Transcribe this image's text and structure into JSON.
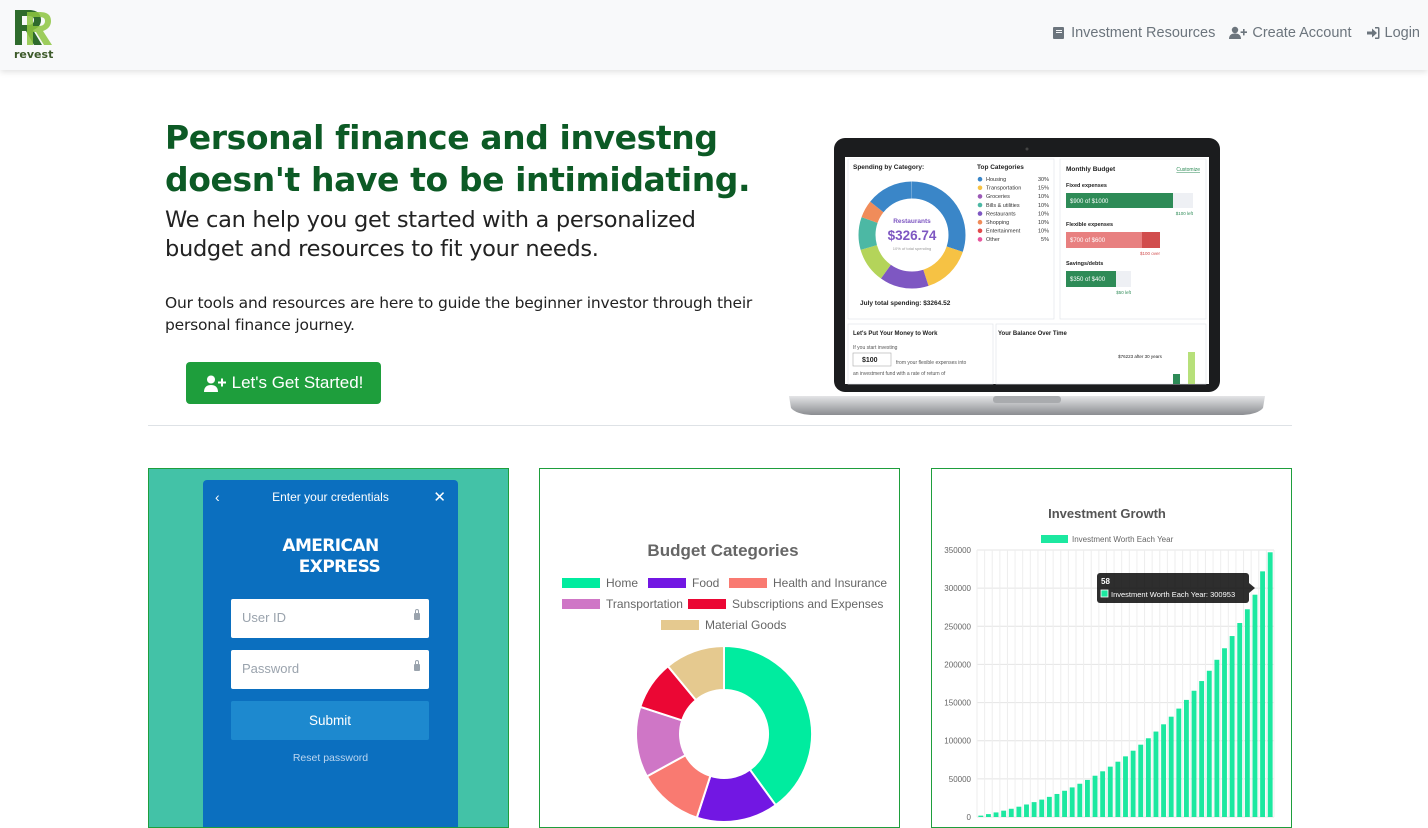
{
  "nav": {
    "brand": "revest",
    "links": [
      {
        "label": "Investment Resources",
        "icon": "book-icon"
      },
      {
        "label": "Create Account",
        "icon": "user-plus-icon"
      },
      {
        "label": "Login",
        "icon": "sign-in-icon"
      }
    ]
  },
  "hero": {
    "title": "Personal finance and investng doesn't have to be intimidating.",
    "subtitle": "We can help you get started with a personalized budget and resources to fit your needs.",
    "body": "Our tools and resources are here to guide the beginner investor through their personal finance journey.",
    "cta_label": "Let's Get Started!"
  },
  "laptop": {
    "spending_title": "Spending by Category:",
    "donut_label": "Restaurants",
    "donut_amount": "$326.74",
    "donut_note": "10% of total spending",
    "total": "July total spending: $3264.52",
    "top_categories_title": "Top Categories",
    "top_categories": [
      {
        "name": "Housing",
        "pct": "30%",
        "color": "#3a86c8"
      },
      {
        "name": "Transportation",
        "pct": "15%",
        "color": "#f6c244"
      },
      {
        "name": "Groceries",
        "pct": "10%",
        "color": "#9b59b6"
      },
      {
        "name": "Bills & utilities",
        "pct": "10%",
        "color": "#4cb8a4"
      },
      {
        "name": "Restaurants",
        "pct": "10%",
        "color": "#7e57c2"
      },
      {
        "name": "Shopping",
        "pct": "10%",
        "color": "#f08c5a"
      },
      {
        "name": "Entertainment",
        "pct": "10%",
        "color": "#e24a4a"
      },
      {
        "name": "Other",
        "pct": "5%",
        "color": "#e8559c"
      }
    ],
    "budget_title": "Monthly Budget",
    "budget_customize": "Customize",
    "fixed_label": "Fixed expenses",
    "fixed_value": "$900 of $1000",
    "fixed_left": "$100 left",
    "flex_label": "Flexible expenses",
    "flex_value": "$700 of $600",
    "flex_over": "$100 over",
    "savings_label": "Savings/debts",
    "savings_value": "$350 of $400",
    "savings_left": "$50 left",
    "invest_title": "Let's Put Your Money to Work",
    "invest_text1": "If you start investing",
    "invest_amount": "$100",
    "invest_text2": "from your flexible expenses into",
    "invest_text3": "an investment fund with a rate of return of",
    "balance_title": "Your Balance Over Time",
    "balance_note": "$76223 after 30 years"
  },
  "amex": {
    "header": "Enter your credentials",
    "logo_line1": "AMERICAN",
    "logo_line2": "EXPRESS",
    "userid_placeholder": "User ID",
    "password_placeholder": "Password",
    "submit_label": "Submit",
    "reset_label": "Reset password"
  },
  "chart_data": [
    {
      "type": "pie",
      "title": "Budget Categories",
      "legend_position": "top",
      "categories": [
        "Home",
        "Food",
        "Health and Insurance",
        "Transportation",
        "Subscriptions and Expenses",
        "Material Goods"
      ],
      "values": [
        40,
        15,
        12,
        13,
        9,
        11
      ],
      "colors": [
        "#00ec9f",
        "#7217e3",
        "#f97a71",
        "#cf76c6",
        "#eb0734",
        "#e5c98f"
      ]
    },
    {
      "type": "bar",
      "title": "Investment Growth",
      "legend_position": "top",
      "series": [
        {
          "name": "Investment Worth Each Year",
          "color": "#1ce8a0",
          "values": [
            1800,
            3800,
            6000,
            8300,
            10800,
            13500,
            16400,
            19500,
            22800,
            26400,
            30200,
            34400,
            38800,
            43600,
            48600,
            54100,
            59900,
            66000,
            72500,
            79500,
            86900,
            94800,
            103200,
            112000,
            121500,
            131500,
            142100,
            153500,
            165500,
            178200,
            191700,
            206100,
            221200,
            237200,
            254300,
            272300,
            291400,
            322000,
            347000
          ]
        }
      ],
      "yticks": [
        "0",
        "50000",
        "100000",
        "150000",
        "200000",
        "250000",
        "300000",
        "350000"
      ],
      "ylim": [
        0,
        350000
      ],
      "tooltip_title": "58",
      "tooltip_text": "Investment Worth Each Year: 300953"
    }
  ]
}
